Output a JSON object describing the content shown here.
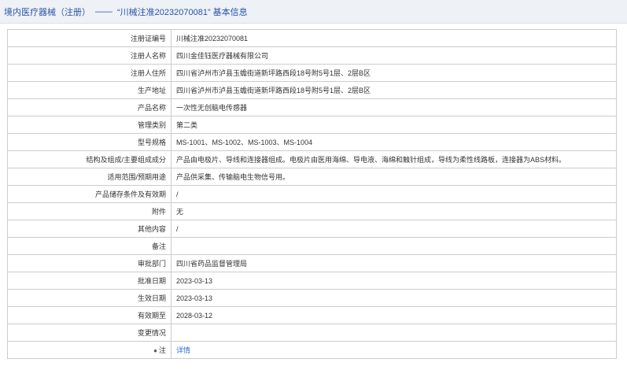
{
  "header": {
    "category": "境内医疗器械（注册）",
    "separator": "——",
    "title": "“川械注准20232070081” 基本信息"
  },
  "rows": [
    {
      "label": "注册证编号",
      "value": "川械注准20232070081"
    },
    {
      "label": "注册人名称",
      "value": "四川金佳钰医疗器械有限公司"
    },
    {
      "label": "注册人住所",
      "value": "四川省泸州市泸县玉蟾街道新坪路西段18号附5号1层、2层B区"
    },
    {
      "label": "生产地址",
      "value": "四川省泸州市泸县玉蟾街道新坪路西段18号附5号1层、2层B区"
    },
    {
      "label": "产品名称",
      "value": "一次性无创脑电传感器"
    },
    {
      "label": "管理类别",
      "value": "第二类"
    },
    {
      "label": "型号规格",
      "value": "MS-1001、MS-1002、MS-1003、MS-1004"
    },
    {
      "label": "结构及组成/主要组成成分",
      "value": "产品由电极片、导线和连接器组成。电极片由医用海绵、导电液、海绵和触针组成，导线为柔性线路板，连接器为ABS材料。"
    },
    {
      "label": "适用范围/预期用途",
      "value": "产品供采集、传输脑电生物信号用。"
    },
    {
      "label": "产品储存条件及有效期",
      "value": "/"
    },
    {
      "label": "附件",
      "value": "无"
    },
    {
      "label": "其他内容",
      "value": "/"
    },
    {
      "label": "备注",
      "value": ""
    },
    {
      "label": "审批部门",
      "value": "四川省药品监督管理局"
    },
    {
      "label": "批准日期",
      "value": "2023-03-13"
    },
    {
      "label": "生效日期",
      "value": "2023-03-13"
    },
    {
      "label": "有效期至",
      "value": "2028-03-12"
    },
    {
      "label": "变更情况",
      "value": ""
    }
  ],
  "note_row": {
    "label": "注",
    "link_text": "详情",
    "icon": "info-icon"
  }
}
